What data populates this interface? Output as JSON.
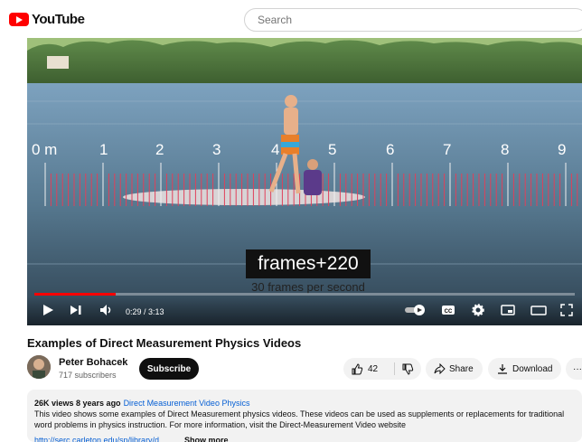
{
  "header": {
    "logo_text": "YouTube",
    "search_placeholder": "Search"
  },
  "player": {
    "ruler_labels": [
      "0 m",
      "1",
      "2",
      "3",
      "4",
      "5",
      "6",
      "7",
      "8",
      "9"
    ],
    "overlay_counter": "frames+220",
    "overlay_fps": "30 frames per second",
    "time": "0:29 / 3:13",
    "progress": 0.15,
    "colors": {
      "progress": "#ff0000"
    }
  },
  "video": {
    "title": "Examples of Direct Measurement Physics Videos",
    "channel": "Peter Bohacek",
    "subscribers": "717 subscribers",
    "subscribe_label": "Subscribe",
    "like_count": "42",
    "share_label": "Share",
    "download_label": "Download",
    "more_label": "···"
  },
  "description": {
    "views_age": "26K views  8 years ago",
    "tag": "Direct Measurement Video Physics",
    "text": "This video shows some examples of Direct Measurement physics videos. These videos can be used as supplements or replacements for traditional word problems in physics instruction. For more information, visit the Direct-Measurement Video website",
    "link": "http://serc.carleton.edu/sp/library/d...",
    "show_more": "Show more"
  },
  "icons": [
    "youtube-logo-icon",
    "play-icon",
    "next-icon",
    "volume-icon",
    "autoplay-toggle-icon",
    "captions-icon",
    "settings-gear-icon",
    "miniplayer-icon",
    "theater-icon",
    "fullscreen-icon",
    "thumbs-up-icon",
    "thumbs-down-icon",
    "share-arrow-icon",
    "download-icon"
  ]
}
